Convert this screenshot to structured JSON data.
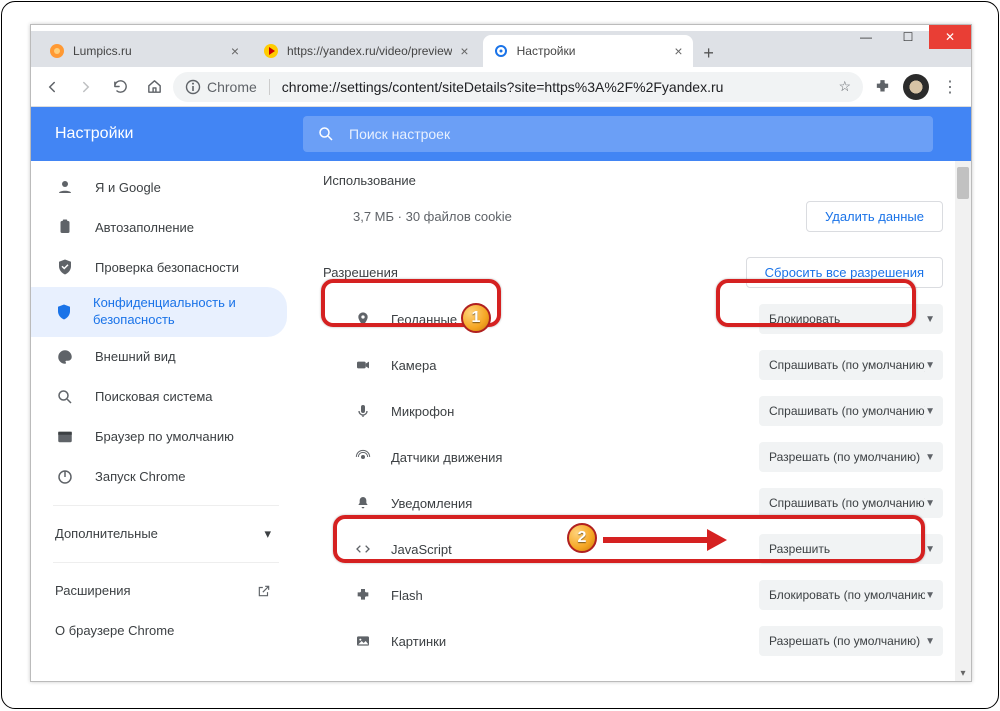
{
  "window": {
    "tabs": [
      {
        "label": "Lumpics.ru",
        "kind": "lumpics"
      },
      {
        "label": "https://yandex.ru/video/preview",
        "kind": "yandex"
      },
      {
        "label": "Настройки",
        "kind": "settings"
      }
    ]
  },
  "omnibox": {
    "prefix": "Chrome",
    "url": "chrome://settings/content/siteDetails?site=https%3A%2F%2Fyandex.ru"
  },
  "header": {
    "title": "Настройки",
    "search_placeholder": "Поиск настроек"
  },
  "sidebar": {
    "items": [
      {
        "label": "Я и Google",
        "icon": "person"
      },
      {
        "label": "Автозаполнение",
        "icon": "clipboard"
      },
      {
        "label": "Проверка безопасности",
        "icon": "check-shield"
      },
      {
        "label": "Конфиденциальность и безопасность",
        "icon": "shield",
        "active": true
      },
      {
        "label": "Внешний вид",
        "icon": "palette"
      },
      {
        "label": "Поисковая система",
        "icon": "search"
      },
      {
        "label": "Браузер по умолчанию",
        "icon": "browser"
      },
      {
        "label": "Запуск Chrome",
        "icon": "power"
      }
    ],
    "advanced_label": "Дополнительные",
    "extensions_label": "Расширения",
    "about_label": "О браузере Chrome"
  },
  "main": {
    "usage_title": "Использование",
    "usage_text": "3,7 МБ · 30 файлов cookie",
    "delete_data_label": "Удалить данные",
    "permissions_title": "Разрешения",
    "reset_label": "Сбросить все разрешения",
    "permissions": [
      {
        "name": "Геоданные",
        "icon": "location",
        "value": "Блокировать"
      },
      {
        "name": "Камера",
        "icon": "camera",
        "value": "Спрашивать (по умолчанию)"
      },
      {
        "name": "Микрофон",
        "icon": "mic",
        "value": "Спрашивать (по умолчанию)"
      },
      {
        "name": "Датчики движения",
        "icon": "sensor",
        "value": "Разрешать (по умолчанию)"
      },
      {
        "name": "Уведомления",
        "icon": "bell",
        "value": "Спрашивать (по умолчанию)"
      },
      {
        "name": "JavaScript",
        "icon": "code",
        "value": "Разрешить"
      },
      {
        "name": "Flash",
        "icon": "plugin",
        "value": "Блокировать (по умолчанию)"
      },
      {
        "name": "Картинки",
        "icon": "image",
        "value": "Разрешать (по умолчанию)"
      }
    ]
  },
  "annotations": {
    "b1": "1",
    "b2": "2"
  }
}
